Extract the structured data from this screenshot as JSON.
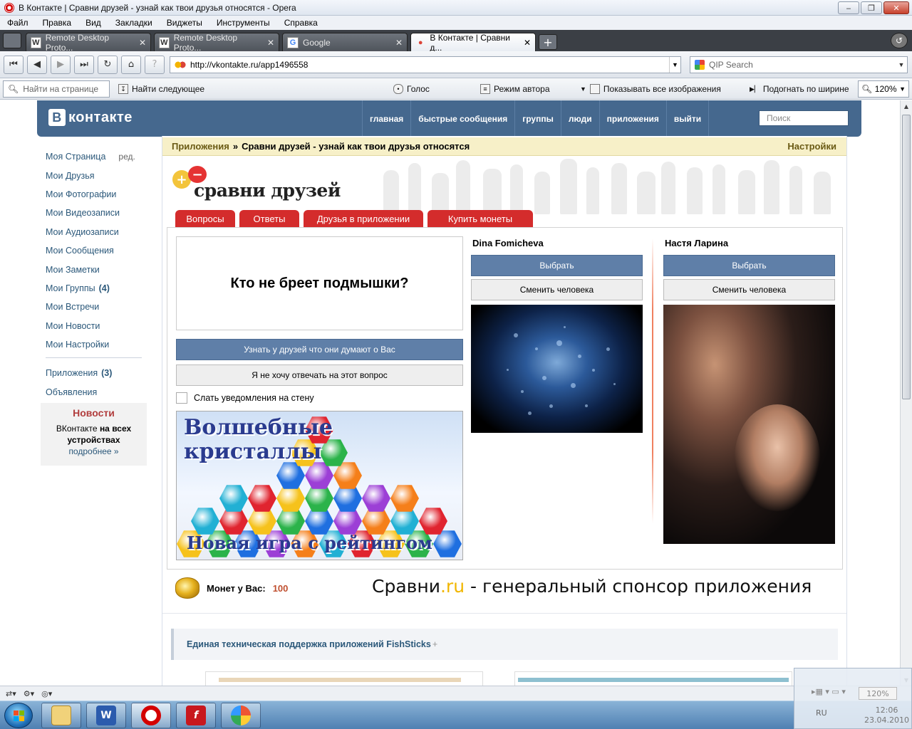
{
  "window": {
    "title": "В Контакте | Сравни друзей - узнай как твои друзья относятся - Opera"
  },
  "menu": [
    "Файл",
    "Правка",
    "Вид",
    "Закладки",
    "Виджеты",
    "Инструменты",
    "Справка"
  ],
  "tabs": [
    {
      "label": "Remote Desktop Proto...",
      "icon": "wikipedia-icon",
      "glyph": "W"
    },
    {
      "label": "Remote Desktop Proto...",
      "icon": "wikipedia-icon",
      "glyph": "W"
    },
    {
      "label": "Google",
      "icon": "google-icon",
      "glyph": "G"
    },
    {
      "label": "В Контакте | Сравни д...",
      "icon": "opera-page-icon",
      "glyph": "●",
      "active": true
    }
  ],
  "address": {
    "url": "http://vkontakte.ru/app1496558",
    "search_placeholder": "QIP Search"
  },
  "toolbar": {
    "find_placeholder": "Найти на странице",
    "find_next": "Найти следующее",
    "voice": "Голос",
    "author_mode": "Режим автора",
    "show_images": "Показывать все изображения",
    "fit_width": "Подогнать по ширине",
    "zoom": "120%"
  },
  "vk": {
    "logo": "контакте",
    "logo_letter": "В",
    "nav": [
      "главная",
      "быстрые сообщения",
      "группы",
      "люди",
      "приложения",
      "выйти"
    ],
    "search_placeholder": "Поиск"
  },
  "sidebar": {
    "items": [
      {
        "label": "Моя Страница",
        "extra": "ред."
      },
      {
        "label": "Мои Друзья"
      },
      {
        "label": "Мои Фотографии"
      },
      {
        "label": "Мои Видеозаписи"
      },
      {
        "label": "Мои Аудиозаписи"
      },
      {
        "label": "Мои Сообщения"
      },
      {
        "label": "Мои Заметки"
      },
      {
        "label": "Мои Группы",
        "count": "(4)"
      },
      {
        "label": "Мои Встречи"
      },
      {
        "label": "Мои Новости"
      },
      {
        "label": "Мои Настройки"
      }
    ],
    "apps": {
      "label": "Приложения",
      "count": "(3)"
    },
    "ads": "Объявления",
    "news": {
      "title": "Новости",
      "text_plain": "ВКонтакте",
      "text_bold": "на всех устройствах",
      "more": "подробнее »"
    }
  },
  "breadcrumb": {
    "section": "Приложения",
    "separator": "»",
    "title": "Сравни друзей - узнай как твои друзья относятся",
    "settings": "Настройки"
  },
  "app": {
    "logo_plus": "+",
    "logo_minus": "−",
    "logo_text": "сравни друзей",
    "tabs": [
      "Вопросы",
      "Ответы",
      "Друзья в приложении",
      "Купить монеты"
    ],
    "question": "Кто не бреет подмышки?",
    "ask_friends": "Узнать у друзей что они думают о Вас",
    "skip": "Я не хочу отвечать на этот вопрос",
    "notify_wall": "Слать уведомления на стену",
    "banner": {
      "line1": "Волшебные",
      "line2": "кристаллы",
      "line3": "Новая игра с рейтингом"
    },
    "person1": {
      "name": "Dina Fomicheva",
      "choose": "Выбрать",
      "change": "Сменить человека"
    },
    "person2": {
      "name": "Настя Ларина",
      "choose": "Выбрать",
      "change": "Сменить человека"
    },
    "coins_label": "Монет у Вас:",
    "coins_value": "100",
    "sponsor_pre": "Сравни",
    "sponsor_ru": ".ru",
    "sponsor_post": " - генеральный спонсор приложения",
    "support": "Единая техническая поддержка приложений FishSticks",
    "support_plus": "+"
  },
  "tray": {
    "zoom": "120%",
    "lang": "RU",
    "time": "12:06",
    "date": "23.04.2010"
  },
  "colors": {
    "vk_blue": "#45688e",
    "vk_link": "#2b587a",
    "app_red": "#d42c2c",
    "button_blue": "#5f7fa8"
  }
}
